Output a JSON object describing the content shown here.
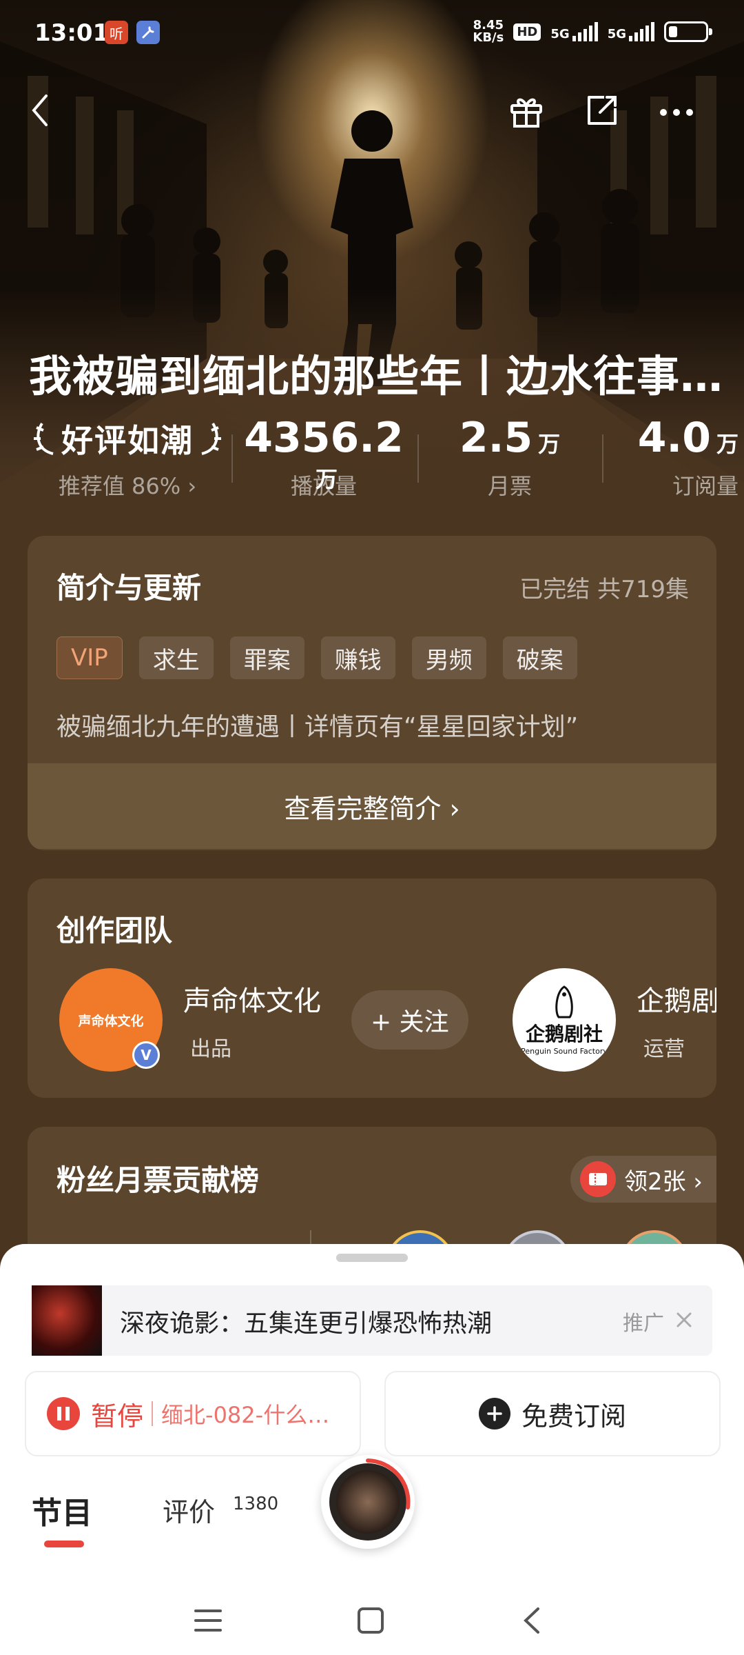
{
  "status_bar": {
    "time": "13:01",
    "app_badge_text": "听",
    "net_speed_value": "8.45",
    "net_speed_unit": "KB/s",
    "hd_badge": "HD",
    "sim1": "5G",
    "sim2": "5G"
  },
  "album": {
    "title": "我被骗到缅北的那些年丨边水往事…",
    "award": "好评如潮",
    "recommend": "推荐值 86% ›",
    "plays_value": "4356.2",
    "plays_unit": "万",
    "plays_label": "播放量",
    "tickets_value": "2.5",
    "tickets_unit": "万",
    "tickets_label": "月票",
    "subs_value": "4.0",
    "subs_unit": "万",
    "subs_label": "订阅量"
  },
  "intro_card": {
    "title": "简介与更新",
    "status": "已完结 共719集",
    "tags": [
      "VIP",
      "求生",
      "罪案",
      "赚钱",
      "男频",
      "破案"
    ],
    "summary": "被骗缅北九年的遭遇丨详情页有“星星回家计划”",
    "more": "查看完整简介 ›"
  },
  "team_card": {
    "title": "创作团队",
    "member1_name": "声命体文化",
    "member1_role": "出品",
    "member1_logo_text": "声命体文化",
    "member1_verified": "V",
    "follow": "+ 关注",
    "member2_name": "企鹅剧社",
    "member2_role": "运营",
    "member2_logo_text": "企鹅剧社",
    "member2_logo_sub": "Penguin Sound Factory"
  },
  "fans_card": {
    "title": "粉丝月票贡献榜",
    "coupon": "领2张 ›"
  },
  "sheet": {
    "promo_text": "深夜诡影：五集连更引爆恐怖热潮",
    "promo_tag": "推广",
    "pause_label": "暂停",
    "episode": "缅北-082-什么…",
    "subscribe": "免费订阅",
    "tab_episodes": "节目",
    "tab_reviews": "评价",
    "review_count": "1380"
  },
  "colors": {
    "accent_red": "#e8453c",
    "hero_bg": "#4a3521",
    "card_bg": "#6a5238",
    "brand_orange": "#f07a2a"
  }
}
